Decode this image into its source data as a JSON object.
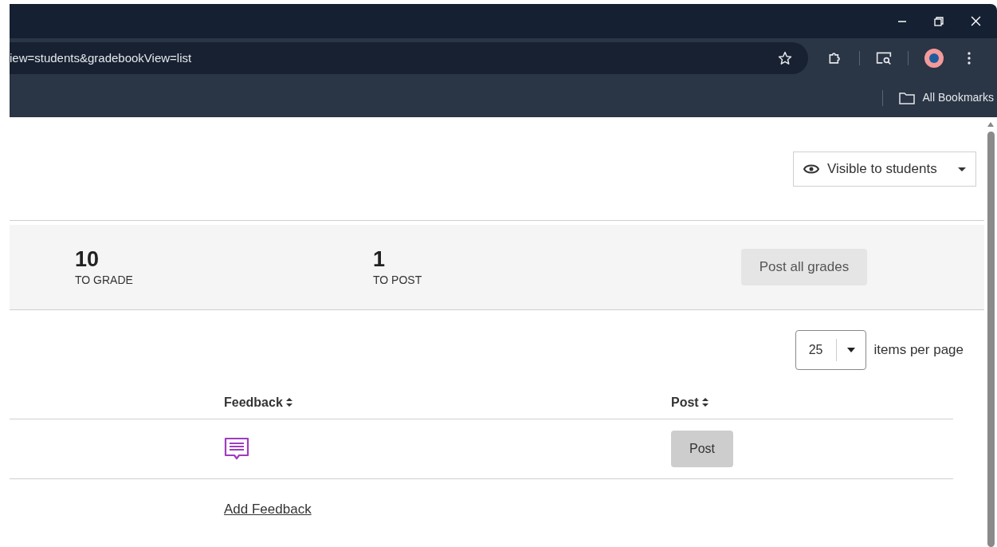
{
  "browser": {
    "url": "iew=students&gradebookView=list",
    "bookmarks_label": "All Bookmarks"
  },
  "visibility_dropdown": {
    "label": "Visible to students"
  },
  "stats": [
    {
      "value": "10",
      "label": "TO GRADE"
    },
    {
      "value": "1",
      "label": "TO POST"
    }
  ],
  "post_all_button": {
    "label": "Post all grades"
  },
  "pagination": {
    "value": "25",
    "label": "items per page"
  },
  "table": {
    "columns": [
      {
        "label": "Feedback"
      },
      {
        "label": "Post"
      }
    ],
    "rows": [
      {
        "feedback": {
          "kind": "icon"
        },
        "post": "Post"
      },
      {
        "feedback": {
          "kind": "link",
          "text": "Add Feedback"
        }
      }
    ]
  }
}
